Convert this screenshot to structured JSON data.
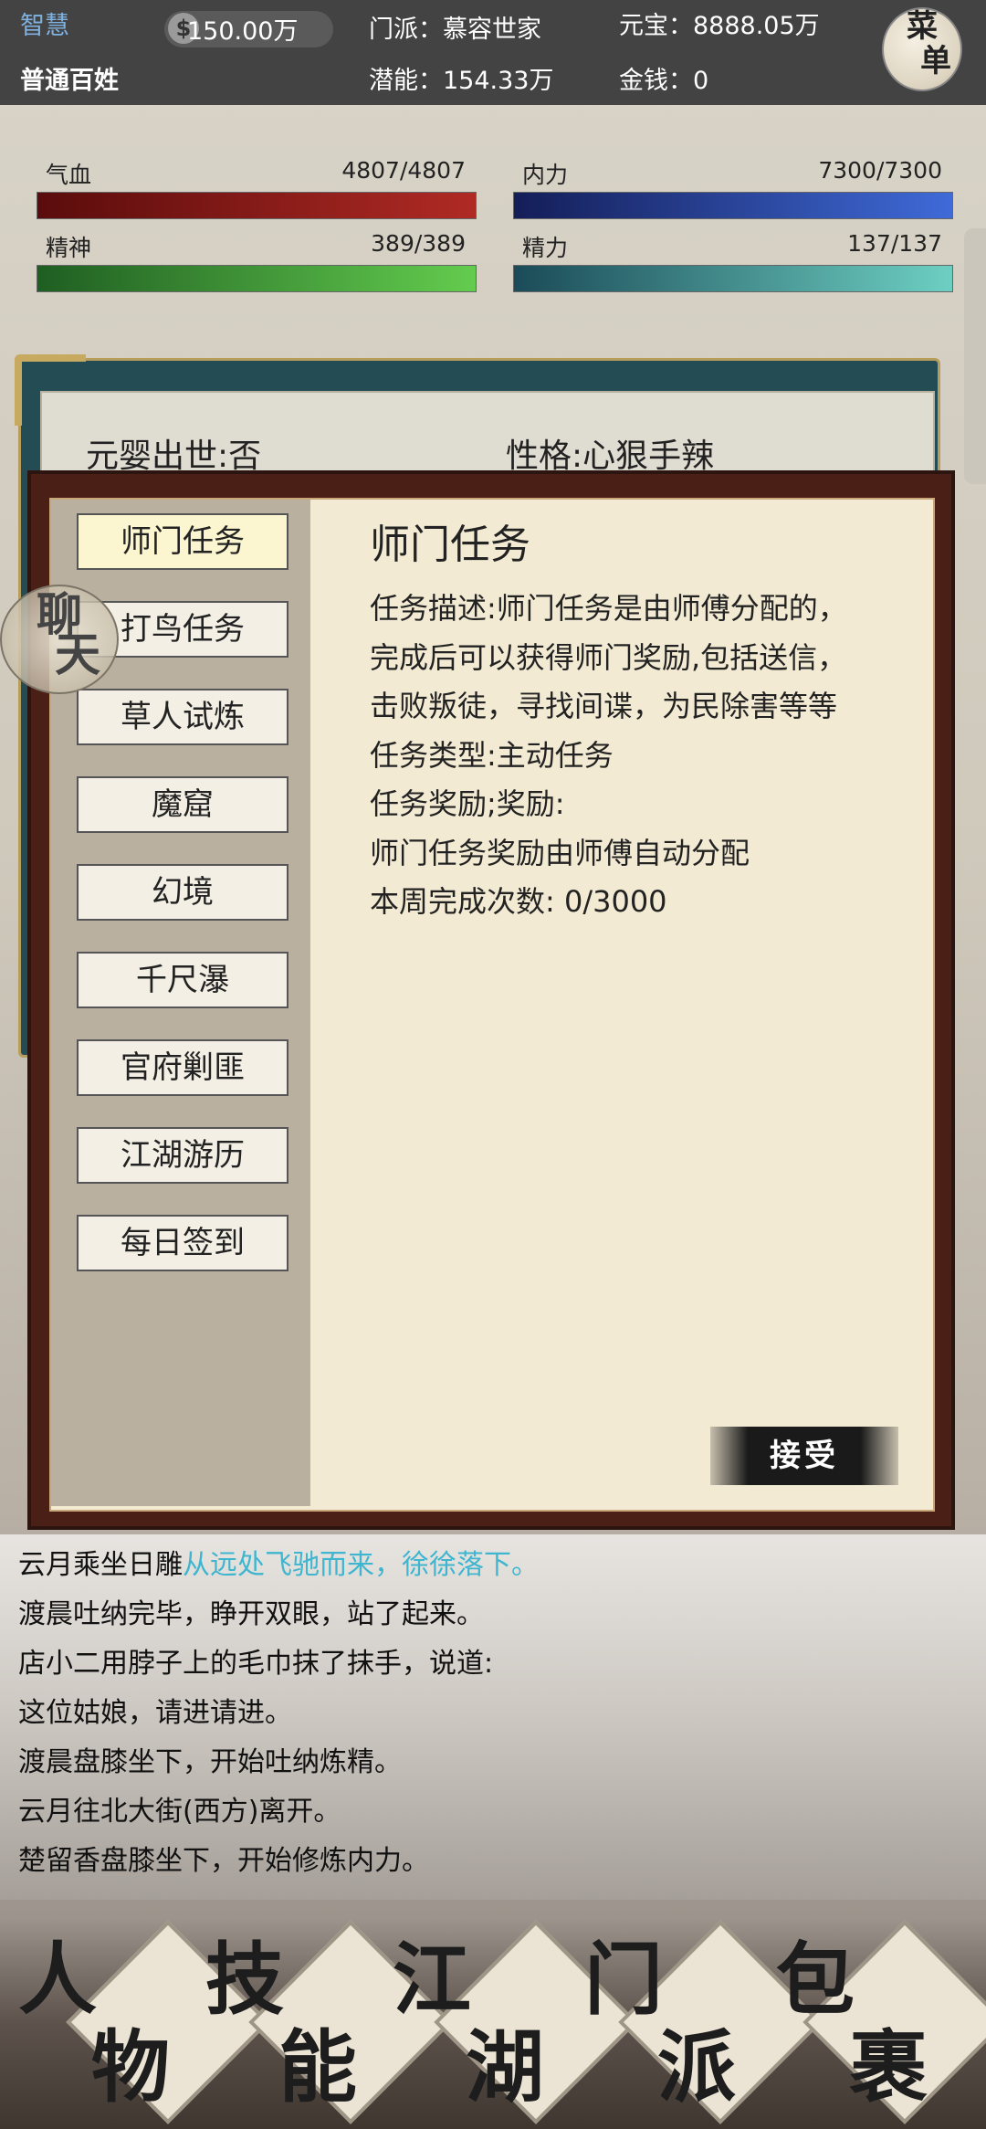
{
  "top": {
    "wisdom_label": "智慧",
    "title": "普通百姓",
    "coin_value": "150.00万",
    "sect": "门派：慕容世家",
    "potential": "潜能：154.33万",
    "ingot": "元宝：8888.05万",
    "money": "金钱：0",
    "menu_line1": "菜",
    "menu_line2": "单"
  },
  "stats": {
    "hp": {
      "label": "气血",
      "value": "4807/4807",
      "fill": 1.0
    },
    "mp": {
      "label": "内力",
      "value": "7300/7300",
      "fill": 1.0
    },
    "sp": {
      "label": "精神",
      "value": "389/389",
      "fill": 1.0
    },
    "en": {
      "label": "精力",
      "value": "137/137",
      "fill": 1.0
    }
  },
  "info": {
    "yuanying": "元婴出世:否",
    "personality": "性格:心狠手辣"
  },
  "chat_badge": {
    "line1": "聊",
    "line2": "天"
  },
  "tasks": {
    "items": [
      "师门任务",
      "打鸟任务",
      "草人试炼",
      "魔窟",
      "幻境",
      "千尺瀑",
      "官府剿匪",
      "江湖游历",
      "每日签到"
    ],
    "active_index": 0,
    "detail_title": "师门任务",
    "detail_lines": [
      "任务描述:师门任务是由师傅分配的，",
      "完成后可以获得师门奖励,包括送信，",
      "击败叛徒，寻找间谍，为民除害等等",
      "任务类型:主动任务",
      "任务奖励;奖励:",
      "师门任务奖励由师傅自动分配",
      "本周完成次数: 0/3000"
    ],
    "accept_label": "接受"
  },
  "log": {
    "first_prefix": "云月乘坐日雕",
    "first_highlight": "从远处飞驰而来，徐徐落下。",
    "lines": [
      "渡晨吐纳完毕，睁开双眼，站了起来。",
      "店小二用脖子上的毛巾抹了抹手，说道:",
      "这位姑娘，请进请进。",
      "渡晨盘膝坐下，开始吐纳炼精。",
      "云月往北大街(西方)离开。",
      "楚留香盘膝坐下，开始修炼内力。"
    ]
  },
  "nav": [
    {
      "a": "人",
      "b": "物"
    },
    {
      "a": "技",
      "b": "能"
    },
    {
      "a": "江",
      "b": "湖"
    },
    {
      "a": "门",
      "b": "派"
    },
    {
      "a": "包",
      "b": "裹"
    }
  ]
}
